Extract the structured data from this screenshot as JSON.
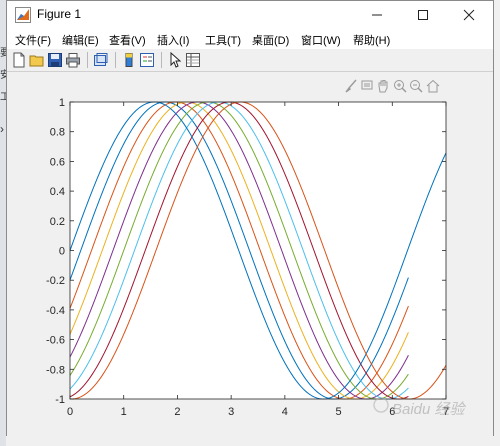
{
  "window": {
    "title": "Figure 1"
  },
  "menu": {
    "items": [
      "文件(F)",
      "编辑(E)",
      "查看(V)",
      "插入(I)",
      "工具(T)",
      "桌面(D)",
      "窗口(W)",
      "帮助(H)"
    ]
  },
  "watermark": "Baidu 经验",
  "chart_data": {
    "type": "line",
    "title": "",
    "xlabel": "",
    "ylabel": "",
    "xlim": [
      0,
      7
    ],
    "ylim": [
      -1,
      1
    ],
    "xticks": [
      0,
      1,
      2,
      3,
      4,
      5,
      6,
      7
    ],
    "xtick_labels": [
      "0",
      "1",
      "2",
      "3",
      "4",
      "5",
      "6",
      "7"
    ],
    "yticks": [
      -1,
      -0.8,
      -0.6,
      -0.4,
      -0.2,
      0,
      0.2,
      0.4,
      0.6,
      0.8,
      1
    ],
    "ytick_labels": [
      "-1",
      "-0.8",
      "-0.6",
      "-0.4",
      "-0.2",
      "0",
      "0.2",
      "0.4",
      "0.6",
      "0.8",
      "1"
    ],
    "grid": false,
    "series_function": "y = sin(x - phase)",
    "series": [
      {
        "phase": 0.2,
        "color": "#0072BD",
        "x_range": [
          0,
          6.3
        ]
      },
      {
        "phase": 0.4,
        "color": "#D95319",
        "x_range": [
          0,
          6.3
        ]
      },
      {
        "phase": 0.6,
        "color": "#EDB120",
        "x_range": [
          0,
          6.3
        ]
      },
      {
        "phase": 0.8,
        "color": "#7E2F8E",
        "x_range": [
          0,
          6.3
        ]
      },
      {
        "phase": 1.0,
        "color": "#77AC30",
        "x_range": [
          0,
          6.3
        ]
      },
      {
        "phase": 1.2,
        "color": "#4DBEEE",
        "x_range": [
          0,
          6.3
        ]
      },
      {
        "phase": 1.4,
        "color": "#A2142F",
        "x_range": [
          0,
          6.3
        ]
      },
      {
        "phase": 0.0,
        "color": "#0072BD",
        "x_range": [
          0,
          7
        ]
      },
      {
        "phase": 1.6,
        "color": "#D95319",
        "x_range": [
          0,
          7
        ]
      }
    ]
  }
}
